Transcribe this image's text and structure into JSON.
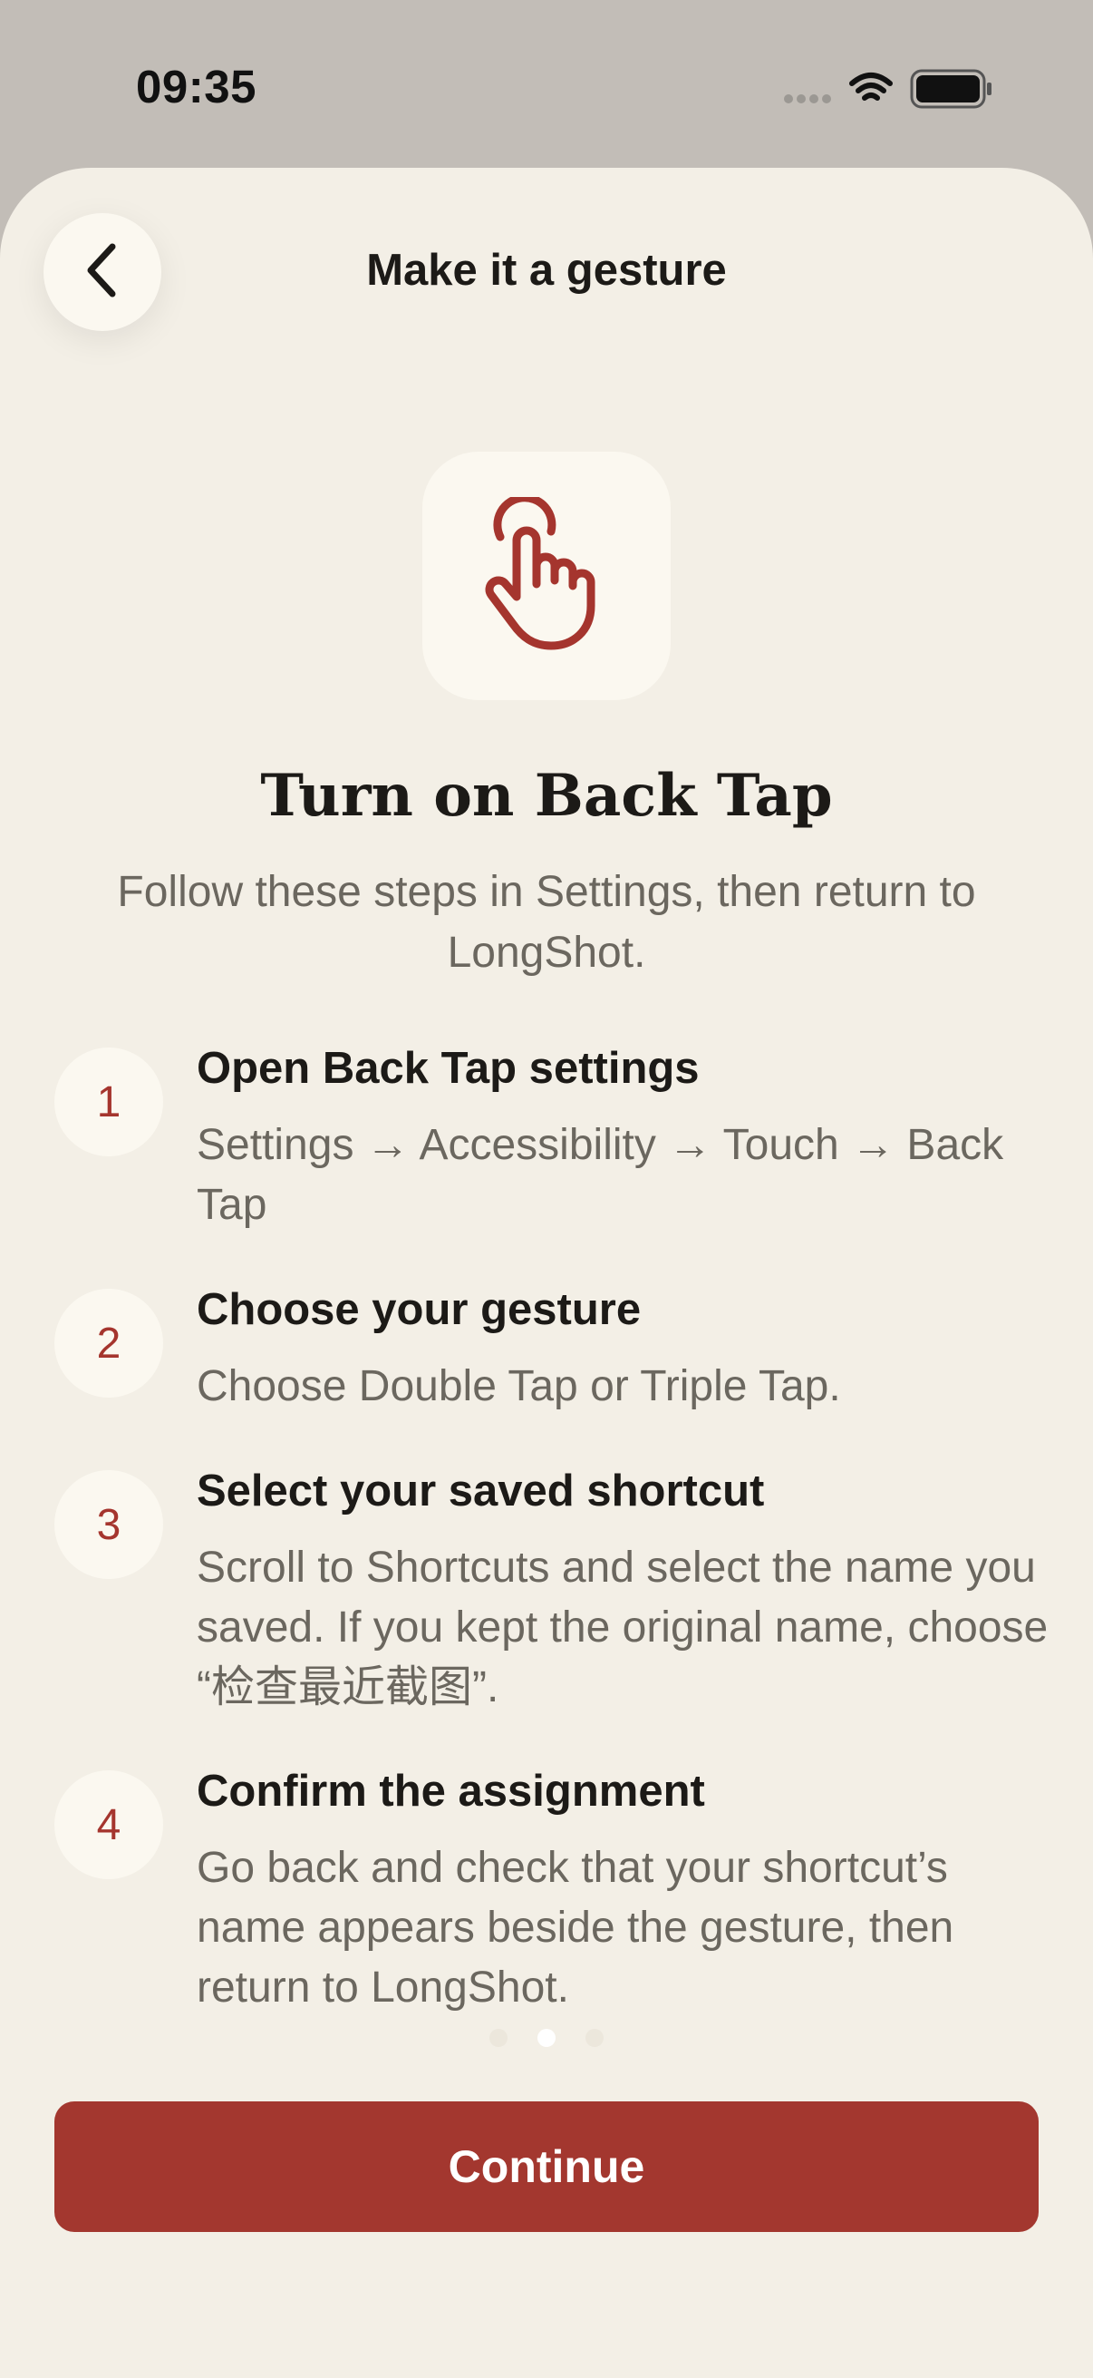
{
  "status_bar": {
    "time": "09:35",
    "icons": [
      "signal-dots-icon",
      "wifi-icon",
      "battery-icon"
    ]
  },
  "header": {
    "title": "Make it a gesture",
    "back_icon": "chevron-left-icon"
  },
  "hero": {
    "icon": "hand-tap-icon",
    "heading": "Turn on Back Tap",
    "subheading": "Follow these steps in Settings, then return to LongShot."
  },
  "steps": [
    {
      "number": "1",
      "title": "Open Back Tap settings",
      "description": "Settings → Accessibility → Touch → Back Tap"
    },
    {
      "number": "2",
      "title": "Choose your gesture",
      "description": "Choose Double Tap or Triple Tap."
    },
    {
      "number": "3",
      "title": "Select your saved shortcut",
      "description": "Scroll to Shortcuts and select the name you saved. If you kept the original name, choose “检查最近截图”."
    },
    {
      "number": "4",
      "title": "Confirm the assignment",
      "description": "Go back and check that your shortcut’s name appears beside the gesture, then return to LongShot."
    }
  ],
  "pagination": {
    "total": 3,
    "current": 2
  },
  "footer": {
    "continue_label": "Continue"
  },
  "colors": {
    "accent": "#a3372f",
    "background": "#f3efe6",
    "tile": "#fbf8f0",
    "text_primary": "#1c1a17",
    "text_secondary": "#6b675f"
  }
}
